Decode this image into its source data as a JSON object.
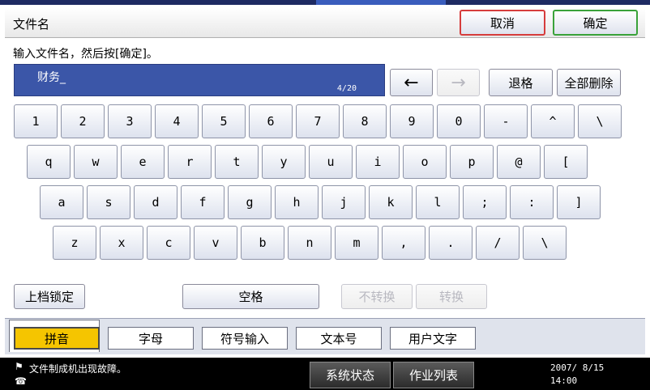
{
  "header": {
    "title": "文件名",
    "cancel_label": "取消",
    "ok_label": "确定"
  },
  "prompt": "输入文件名，然后按[确定]。",
  "input": {
    "value": "财务_",
    "count": "4/20"
  },
  "controls": {
    "left_arrow": "←",
    "right_arrow": "→",
    "backspace_label": "退格",
    "delete_all_label": "全部删除"
  },
  "keyboard": {
    "row1": [
      "1",
      "2",
      "3",
      "4",
      "5",
      "6",
      "7",
      "8",
      "9",
      "0",
      "-",
      "^",
      "\\"
    ],
    "row2": [
      "q",
      "w",
      "e",
      "r",
      "t",
      "y",
      "u",
      "i",
      "o",
      "p",
      "@",
      "["
    ],
    "row3": [
      "a",
      "s",
      "d",
      "f",
      "g",
      "h",
      "j",
      "k",
      "l",
      ";",
      ":",
      "]"
    ],
    "row4": [
      "z",
      "x",
      "c",
      "v",
      "b",
      "n",
      "m",
      ",",
      ".",
      "/",
      "\\"
    ]
  },
  "bottom_controls": {
    "shift_lock_label": "上档锁定",
    "space_label": "空格",
    "no_convert_label": "不转换",
    "convert_label": "转换"
  },
  "tabs": [
    {
      "label": "拼音",
      "active": true
    },
    {
      "label": "字母",
      "active": false
    },
    {
      "label": "符号输入",
      "active": false
    },
    {
      "label": "文本号",
      "active": false
    },
    {
      "label": "用户文字",
      "active": false
    }
  ],
  "status": {
    "message": "文件制成机出现故障。",
    "system_status_label": "系统状态",
    "job_list_label": "作业列表",
    "date": "2007/ 8/15",
    "time": "14:00"
  },
  "colors": {
    "input_bg": "#3b56a8",
    "active_tab": "#f5c500",
    "cancel_border": "#d63c3c",
    "ok_border": "#3aa23a"
  }
}
